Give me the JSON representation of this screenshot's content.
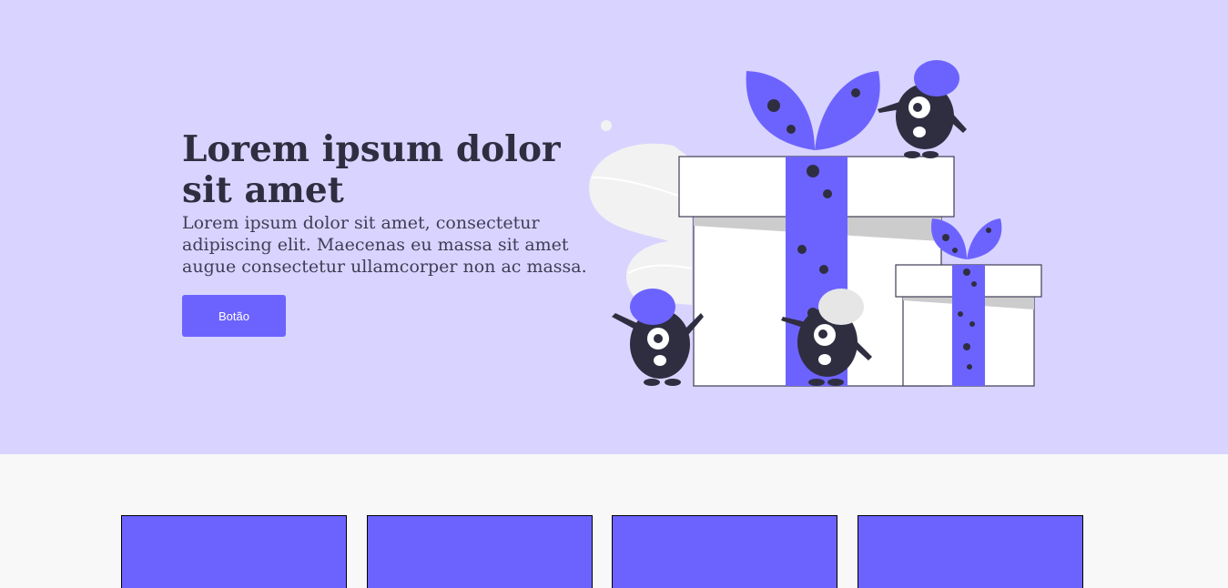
{
  "hero": {
    "title": "Lorem ipsum dolor sit amet",
    "text": "Lorem ipsum dolor sit amet, consectetur adipiscing elit. Maecenas eu massa sit amet augue consectetur ullamcorper non ac massa.",
    "button_label": "Botão"
  },
  "colors": {
    "hero_bg": "#d8d4ff",
    "accent": "#6c63ff",
    "dark": "#2f2e41",
    "page_bg": "#f8f8f8"
  },
  "illustration": {
    "icon": "gift-boxes-monsters-illustration"
  },
  "cards": [
    {},
    {},
    {},
    {}
  ]
}
